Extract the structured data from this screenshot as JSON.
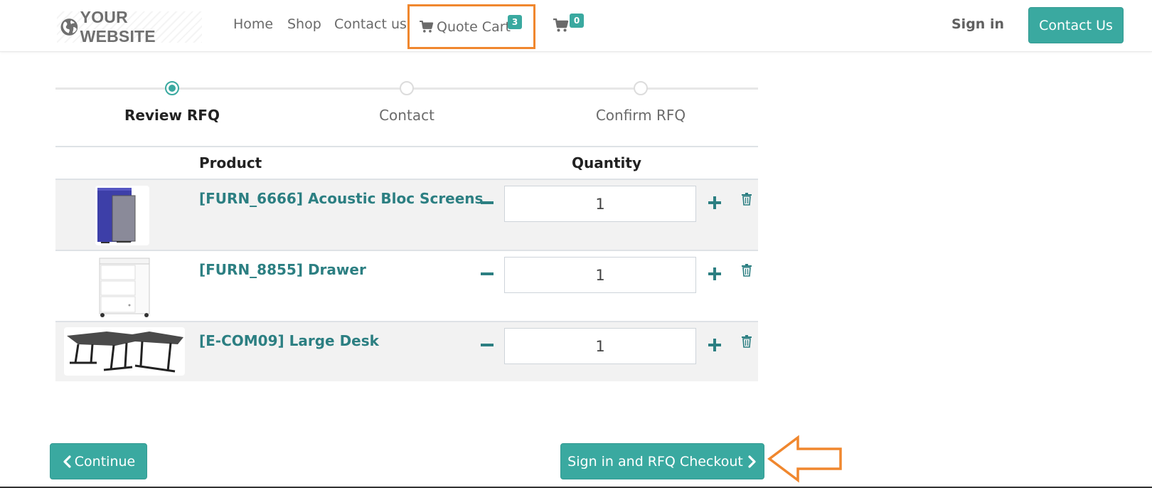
{
  "brand": {
    "logo_text": "YOUR WEBSITE",
    "logo_icon": "globe-icon"
  },
  "nav": {
    "links": [
      {
        "label": "Home"
      },
      {
        "label": "Shop"
      },
      {
        "label": "Contact us"
      }
    ],
    "quote_cart": {
      "label": "Quote Cart",
      "count": "3",
      "icon": "cart-icon"
    },
    "cart": {
      "count": "0",
      "icon": "cart-icon"
    },
    "sign_in": "Sign in",
    "contact_button": "Contact Us"
  },
  "steps": [
    {
      "label": "Review RFQ",
      "active": true
    },
    {
      "label": "Contact",
      "active": false
    },
    {
      "label": "Confirm RFQ",
      "active": false
    }
  ],
  "table": {
    "headers": {
      "product": "Product",
      "quantity": "Quantity"
    },
    "rows": [
      {
        "name": "[FURN_6666] Acoustic Bloc Screens",
        "quantity": "1"
      },
      {
        "name": "[FURN_8855] Drawer",
        "quantity": "1"
      },
      {
        "name": "[E-COM09] Large Desk",
        "quantity": "1"
      }
    ]
  },
  "actions": {
    "continue": "Continue",
    "checkout": "Sign in and RFQ Checkout"
  },
  "colors": {
    "accent": "#3aa9a0",
    "link": "#2c7f82",
    "annotation": "#f0872e"
  }
}
